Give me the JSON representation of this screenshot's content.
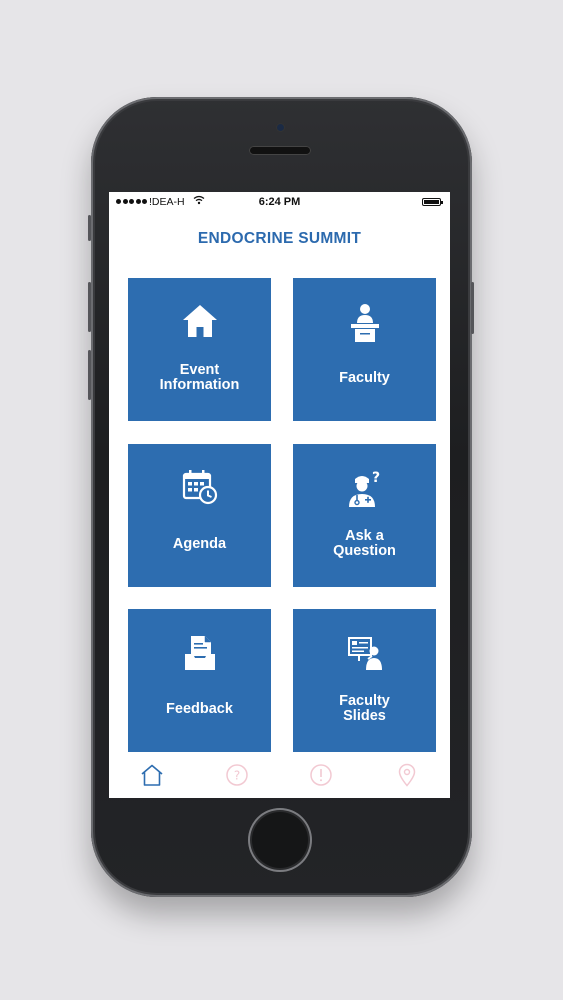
{
  "status_bar": {
    "carrier": "!DEA-H",
    "time": "6:24 PM"
  },
  "app": {
    "title": "ENDOCRINE SUMMIT"
  },
  "tiles": [
    {
      "label": "Event\nInformation",
      "icon": "home-icon"
    },
    {
      "label": "Faculty",
      "icon": "podium-speaker-icon"
    },
    {
      "label": "Agenda",
      "icon": "calendar-clock-icon"
    },
    {
      "label": "Ask a\nQuestion",
      "icon": "doctor-question-icon"
    },
    {
      "label": "Feedback",
      "icon": "document-tray-icon"
    },
    {
      "label": "Faculty\nSlides",
      "icon": "presentation-board-icon"
    }
  ],
  "tab_bar": {
    "items": [
      {
        "icon": "home-outline-icon",
        "active": true
      },
      {
        "icon": "question-circle-icon",
        "active": false
      },
      {
        "icon": "info-circle-icon",
        "active": false
      },
      {
        "icon": "map-pin-icon",
        "active": false
      }
    ]
  },
  "colors": {
    "accent": "#2d6db0",
    "title": "#2c6aae",
    "tab_active": "#2d6db0",
    "tab_inactive": "#f2c9d2",
    "background": "#e6e5e8"
  }
}
